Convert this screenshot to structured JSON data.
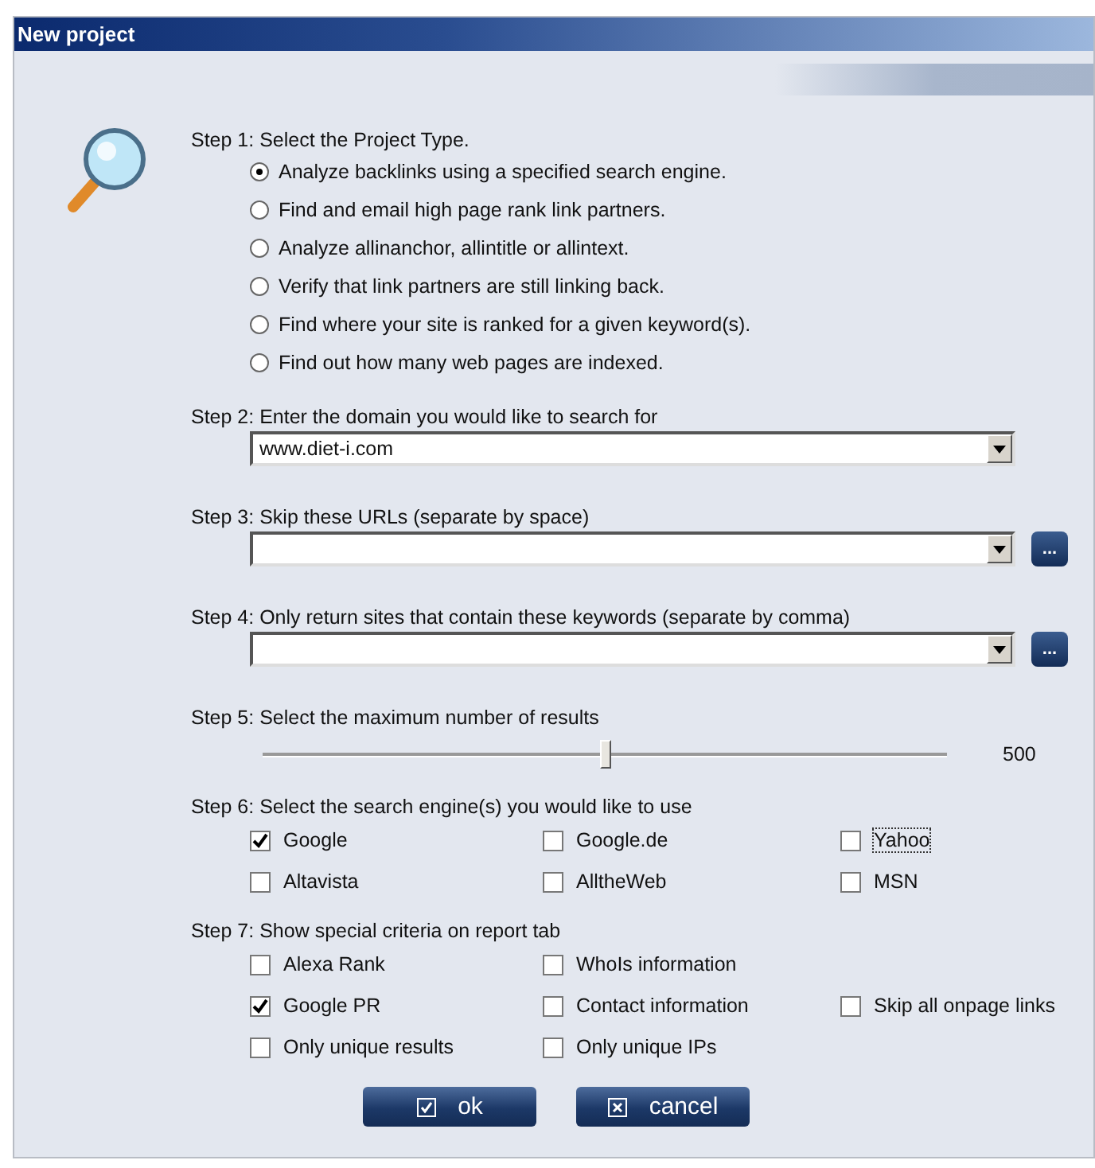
{
  "window": {
    "title": "New project"
  },
  "step1": {
    "label": "Step 1: Select the Project Type.",
    "options": [
      {
        "label": "Analyze backlinks using a specified search engine.",
        "selected": true
      },
      {
        "label": "Find and email high page rank link partners.",
        "selected": false
      },
      {
        "label": "Analyze allinanchor, allintitle or allintext.",
        "selected": false
      },
      {
        "label": "Verify that link partners are still linking back.",
        "selected": false
      },
      {
        "label": "Find where your site is ranked for a given keyword(s).",
        "selected": false
      },
      {
        "label": "Find out how many web pages are indexed.",
        "selected": false
      }
    ]
  },
  "step2": {
    "label": "Step 2: Enter the domain you would like to search for",
    "value": "www.diet-i.com"
  },
  "step3": {
    "label": "Step 3: Skip these URLs (separate by space)",
    "browse": "..."
  },
  "step4": {
    "label": "Step 4: Only return sites that contain these keywords (separate by comma)",
    "browse": "..."
  },
  "step5": {
    "label": "Step 5: Select the maximum number of results",
    "level": 0.5,
    "reading": "500"
  },
  "step6": {
    "label": "Step 6: Select the search engine(s) you would like to use",
    "rows": [
      [
        {
          "label": "Google",
          "checked": true,
          "focused": false
        },
        {
          "label": "Google.de",
          "checked": false,
          "focused": false
        },
        {
          "label": "Yahoo",
          "checked": false,
          "focused": true
        }
      ],
      [
        {
          "label": "Altavista",
          "checked": false,
          "focused": false
        },
        {
          "label": "AlltheWeb",
          "checked": false,
          "focused": false
        },
        {
          "label": "MSN",
          "checked": false,
          "focused": false
        }
      ]
    ]
  },
  "step7": {
    "label": "Step 7: Show special criteria on report tab",
    "rows": [
      [
        {
          "label": "Alexa Rank",
          "checked": false,
          "focused": false
        },
        {
          "label": "WhoIs information",
          "checked": false,
          "focused": false
        }
      ],
      [
        {
          "label": "Google PR",
          "checked": true,
          "focused": false
        },
        {
          "label": "Contact information",
          "checked": false,
          "focused": false
        },
        {
          "label": "Skip all onpage links",
          "checked": false,
          "focused": false
        }
      ],
      [
        {
          "label": "Only unique results",
          "checked": false,
          "focused": false
        },
        {
          "label": "Only unique IPs",
          "checked": false,
          "focused": false
        }
      ]
    ]
  },
  "buttons": [
    {
      "kind": "ok",
      "label": "ok"
    },
    {
      "kind": "cancel",
      "label": "cancel"
    }
  ]
}
